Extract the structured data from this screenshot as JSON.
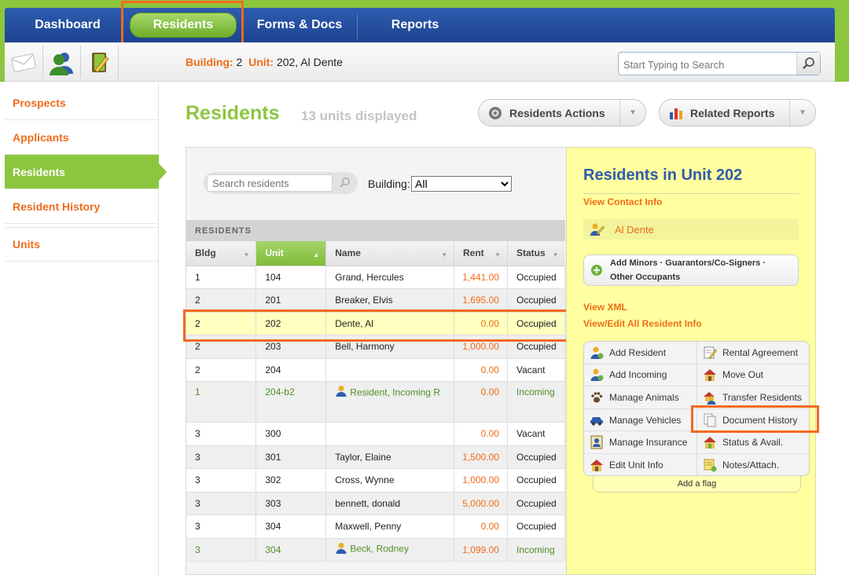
{
  "nav": {
    "tabs": [
      {
        "label": "Dashboard"
      },
      {
        "label": "Residents"
      },
      {
        "label": "Forms & Docs"
      },
      {
        "label": "Reports"
      }
    ]
  },
  "breadcrumb": {
    "building_label": "Building:",
    "building_value": "2",
    "unit_label": "Unit:",
    "unit_value": "202, Al Dente"
  },
  "global_search": {
    "placeholder": "Start Typing to Search"
  },
  "sidebar": {
    "items": [
      {
        "label": "Prospects"
      },
      {
        "label": "Applicants"
      },
      {
        "label": "Residents"
      },
      {
        "label": "Resident History"
      },
      {
        "label": "Units"
      }
    ]
  },
  "main": {
    "title": "Residents",
    "units_displayed": "13 units displayed",
    "residents_actions_label": "Residents Actions",
    "related_reports_label": "Related Reports",
    "search_placeholder": "Search residents",
    "building_label": "Building:",
    "building_selected": "All",
    "section_header": "RESIDENTS",
    "columns": [
      "Bldg",
      "Unit",
      "Name",
      "Rent",
      "Status"
    ],
    "rows": [
      {
        "bldg": "1",
        "unit": "104",
        "name": "Grand, Hercules",
        "rent": "1,441.00",
        "status": "Occupied"
      },
      {
        "bldg": "2",
        "unit": "201",
        "name": "Breaker, Elvis",
        "rent": "1,695.00",
        "status": "Occupied"
      },
      {
        "bldg": "2",
        "unit": "202",
        "name": "Dente, Al",
        "rent": "0.00",
        "status": "Occupied"
      },
      {
        "bldg": "2",
        "unit": "203",
        "name": "Bell, Harmony",
        "rent": "1,000.00",
        "status": "Occupied"
      },
      {
        "bldg": "2",
        "unit": "204",
        "name": "",
        "rent": "0.00",
        "status": "Vacant"
      },
      {
        "bldg": "1",
        "unit": "204-b2",
        "name": "Resident, Incoming R",
        "rent": "0.00",
        "status": "Incoming"
      },
      {
        "bldg": "3",
        "unit": "300",
        "name": "",
        "rent": "0.00",
        "status": "Vacant"
      },
      {
        "bldg": "3",
        "unit": "301",
        "name": "Taylor, Elaine",
        "rent": "1,500.00",
        "status": "Occupied"
      },
      {
        "bldg": "3",
        "unit": "302",
        "name": "Cross, Wynne",
        "rent": "1,000.00",
        "status": "Occupied"
      },
      {
        "bldg": "3",
        "unit": "303",
        "name": "bennett, donald",
        "rent": "5,000.00",
        "status": "Occupied"
      },
      {
        "bldg": "3",
        "unit": "304",
        "name": "Maxwell, Penny",
        "rent": "0.00",
        "status": "Occupied"
      },
      {
        "bldg": "3",
        "unit": "304",
        "name": "Beck, Rodney",
        "rent": "1,099.00",
        "status": "Incoming"
      }
    ]
  },
  "unit_panel": {
    "title": "Residents in Unit 202",
    "view_contact": "View Contact Info",
    "resident_name": "Al Dente",
    "add_minors_line1": "Add Minors · Guarantors/Co-Signers ·",
    "add_minors_line2": "Other Occupants",
    "view_xml": "View XML",
    "view_edit_all": "View/Edit All Resident Info",
    "actions": [
      {
        "label": "Add Resident",
        "icon": "add-person-icon"
      },
      {
        "label": "Rental Agreement",
        "icon": "document-edit-icon"
      },
      {
        "label": "Add Incoming",
        "icon": "add-person-icon"
      },
      {
        "label": "Move Out",
        "icon": "house-icon"
      },
      {
        "label": "Manage Animals",
        "icon": "paw-icon"
      },
      {
        "label": "Transfer Residents",
        "icon": "transfer-person-icon"
      },
      {
        "label": "Manage Vehicles",
        "icon": "car-icon"
      },
      {
        "label": "Document History",
        "icon": "documents-icon"
      },
      {
        "label": "Manage Insurance",
        "icon": "insurance-icon"
      },
      {
        "label": "Status & Avail.",
        "icon": "house-status-icon"
      },
      {
        "label": "Edit Unit Info",
        "icon": "house-edit-icon"
      },
      {
        "label": "Notes/Attach.",
        "icon": "notes-icon"
      }
    ],
    "add_flag": "Add a flag"
  },
  "colors": {
    "accent_green": "#8cc63f",
    "nav_blue": "#2e5cae",
    "link_orange": "#ef6c1a",
    "highlight_orange": "#f26a21",
    "panel_yellow": "#ffff9f"
  }
}
